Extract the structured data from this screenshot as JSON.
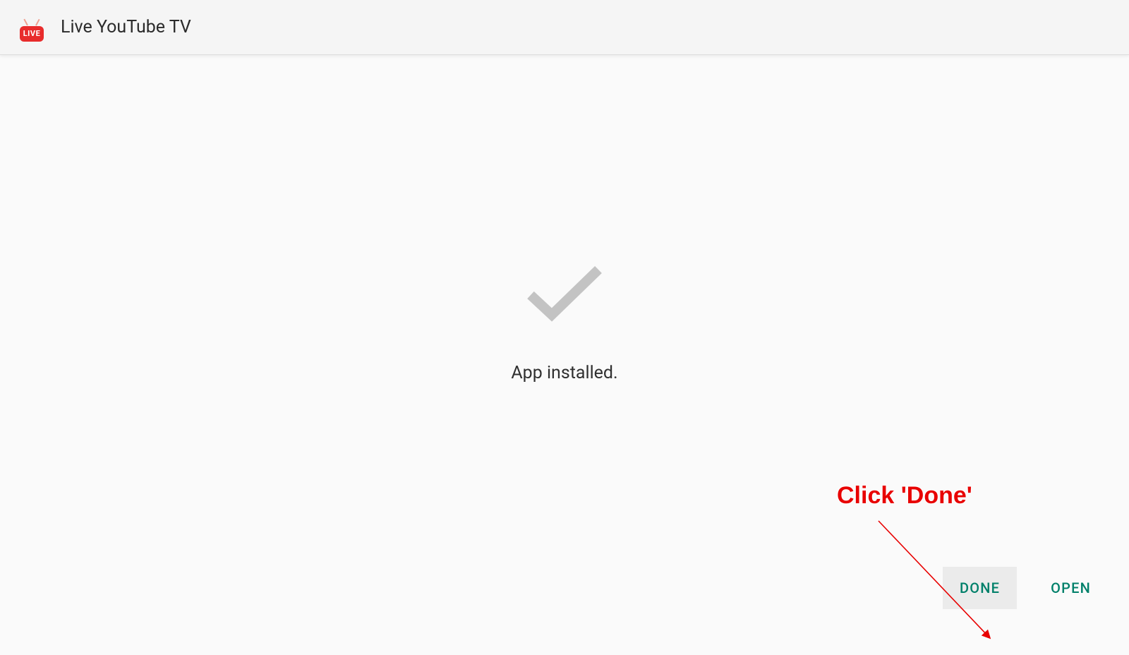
{
  "header": {
    "logo_badge_text": "LIVE",
    "title": "Live YouTube TV"
  },
  "main": {
    "status_text": "App installed."
  },
  "buttons": {
    "done_label": "DONE",
    "open_label": "OPEN"
  },
  "annotation": {
    "text": "Click 'Done'"
  },
  "colors": {
    "accent_red": "#e82c2c",
    "button_teal": "#00806a",
    "annotation_red": "#e80000"
  }
}
